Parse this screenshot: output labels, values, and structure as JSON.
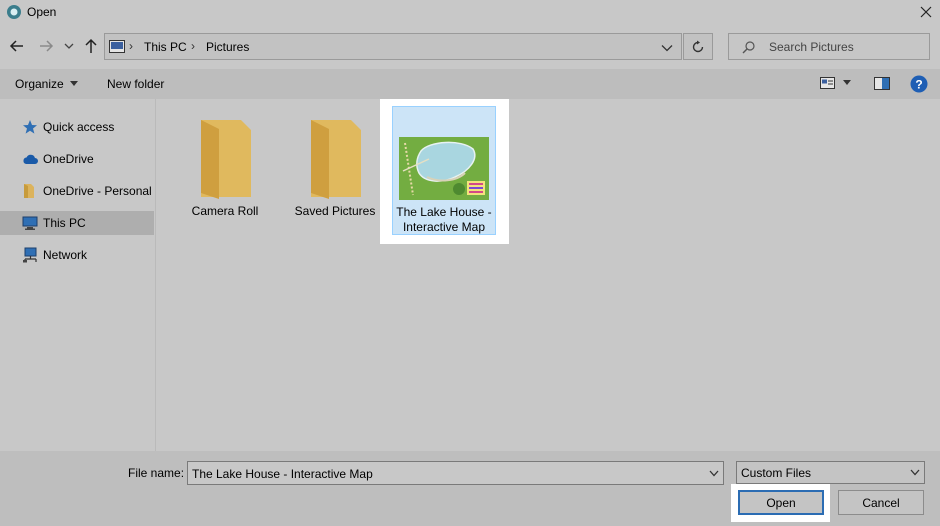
{
  "window": {
    "title": "Open"
  },
  "address": {
    "segments": [
      "This PC",
      "Pictures"
    ]
  },
  "search": {
    "placeholder": "Search Pictures"
  },
  "toolbar": {
    "organize": "Organize",
    "new_folder": "New folder"
  },
  "sidebar": {
    "items": [
      {
        "label": "Quick access",
        "icon": "star-icon"
      },
      {
        "label": "OneDrive",
        "icon": "cloud-icon"
      },
      {
        "label": "OneDrive - Personal",
        "icon": "folder-icon"
      },
      {
        "label": "This PC",
        "icon": "computer-icon",
        "selected": true
      },
      {
        "label": "Network",
        "icon": "network-icon"
      }
    ]
  },
  "files": [
    {
      "name": "Camera Roll",
      "type": "folder"
    },
    {
      "name": "Saved Pictures",
      "type": "folder"
    },
    {
      "name_line1": "The Lake House -",
      "name_line2": "Interactive Map",
      "type": "image",
      "selected": true
    }
  ],
  "footer": {
    "file_name_label": "File name:",
    "file_name_value": "The Lake House - Interactive Map",
    "file_type": "Custom Files",
    "open_label": "Open",
    "cancel_label": "Cancel"
  },
  "colors": {
    "selection": "#cce4f7",
    "selection_border": "#99d1ff",
    "folder": "#dcb35c",
    "help": "#1e5eb4"
  }
}
